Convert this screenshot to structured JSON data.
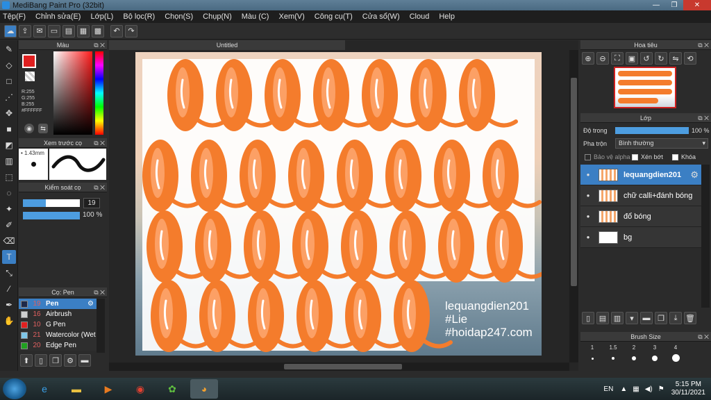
{
  "window": {
    "title": "MediBang Paint Pro (32bit)",
    "controls": [
      "—",
      "❐",
      "✕"
    ]
  },
  "menu": [
    "Tệp(F)",
    "Chỉnh sửa(E)",
    "Lớp(L)",
    "Bộ lọc(R)",
    "Chọn(S)",
    "Chụp(N)",
    "Màu (C)",
    "Xem(V)",
    "Công cụ(T)",
    "Cửa sổ(W)",
    "Cloud",
    "Help"
  ],
  "color_panel": {
    "title": "Màu",
    "r": "R:255",
    "g": "G:255",
    "b": "B:255",
    "hex": "#FFFFFF",
    "primary_color": "#e02020",
    "secondary_color": "#ffffff"
  },
  "brush_preview": {
    "title": "Xem trước cọ",
    "size": "1.43mm"
  },
  "brush_control": {
    "title": "Kiểm soát cọ",
    "size_value": "19",
    "size_fraction": 0.4,
    "opacity_value": "100 %",
    "opacity_fraction": 1.0
  },
  "brush_list": {
    "title": "Cọ: Pen",
    "items": [
      {
        "num": "19",
        "name": "Pen",
        "color": "#1e2a4a",
        "selected": true
      },
      {
        "num": "16",
        "name": "Airbrush",
        "color": "#cfcfcf",
        "selected": false
      },
      {
        "num": "10",
        "name": "G Pen",
        "color": "#e02020",
        "selected": false
      },
      {
        "num": "21",
        "name": "Watercolor (Wet",
        "color": "#7fc6e8",
        "selected": false
      },
      {
        "num": "20",
        "name": "Edge Pen",
        "color": "#20a020",
        "selected": false
      }
    ]
  },
  "canvas": {
    "tab": "Untitled",
    "watermark": [
      "lequangdien201",
      "#Lie",
      "#hoidap247.com"
    ]
  },
  "navigator": {
    "title": "Hoa tiêu"
  },
  "layer_panel": {
    "title": "Lớp",
    "opacity_label": "Độ trong",
    "opacity_value": "100 %",
    "opacity_fraction": 1.0,
    "blend_label": "Pha trộn",
    "blend_value": "Bình thường",
    "protect_alpha": "Bảo vệ alpha",
    "clipping": "Xén bớt",
    "lock": "Khóa",
    "layers": [
      {
        "name": "lequangdien201",
        "selected": true
      },
      {
        "name": "chữ calli+đánh bóng",
        "selected": false
      },
      {
        "name": "đổ bóng",
        "selected": false
      },
      {
        "name": "bg",
        "selected": false
      }
    ]
  },
  "brush_size": {
    "title": "Brush Size",
    "sizes": [
      "1",
      "1.5",
      "2",
      "3",
      "4"
    ]
  },
  "taskbar": {
    "lang": "EN",
    "time": "5:15 PM",
    "date": "30/11/2021"
  }
}
